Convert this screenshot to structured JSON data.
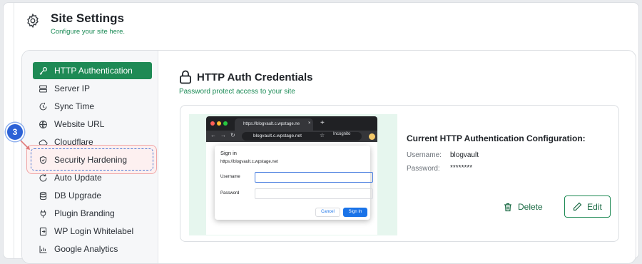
{
  "header": {
    "title": "Site Settings",
    "subtitle": "Configure your site here."
  },
  "sidebar": {
    "items": [
      {
        "label": "HTTP Authentication",
        "icon": "key-icon"
      },
      {
        "label": "Server IP",
        "icon": "server-icon"
      },
      {
        "label": "Sync Time",
        "icon": "sync-icon"
      },
      {
        "label": "Website URL",
        "icon": "globe-icon"
      },
      {
        "label": "Cloudflare",
        "icon": "cloud-icon"
      },
      {
        "label": "Security Hardening",
        "icon": "shield-icon"
      },
      {
        "label": "Auto Update",
        "icon": "refresh-icon"
      },
      {
        "label": "DB Upgrade",
        "icon": "database-icon"
      },
      {
        "label": "Plugin Branding",
        "icon": "plug-icon"
      },
      {
        "label": "WP Login Whitelabel",
        "icon": "login-icon"
      },
      {
        "label": "Google Analytics",
        "icon": "chart-icon"
      }
    ],
    "active_index": 0,
    "highlighted_index": 5
  },
  "step_badge": "3",
  "content": {
    "title": "HTTP Auth Credentials",
    "subtitle": "Password protect access to your site"
  },
  "preview": {
    "tab_title": "https://blogvault.c.wpstage.ne",
    "tab_close": "×",
    "new_tab": "+",
    "url": "blogvault.c.wpstage.net",
    "incognito_label": "Incognito",
    "dialog": {
      "title": "Sign in",
      "url": "https://blogvault.c.wpstage.net",
      "username_label": "Username",
      "password_label": "Password",
      "cancel": "Cancel",
      "sign_in": "Sign In"
    }
  },
  "config": {
    "title": "Current HTTP Authentication Configuration:",
    "username_label": "Username:",
    "username_value": "blogvault",
    "password_label": "Password:",
    "password_value": "********"
  },
  "actions": {
    "delete_label": "Delete",
    "edit_label": "Edit"
  },
  "colors": {
    "accent": "#1e8a55",
    "subtitle_green": "#1a8a55",
    "badge_blue": "#2d62d6",
    "highlight_red": "#f0a4a4",
    "preview_bg": "#e6f6ee"
  }
}
